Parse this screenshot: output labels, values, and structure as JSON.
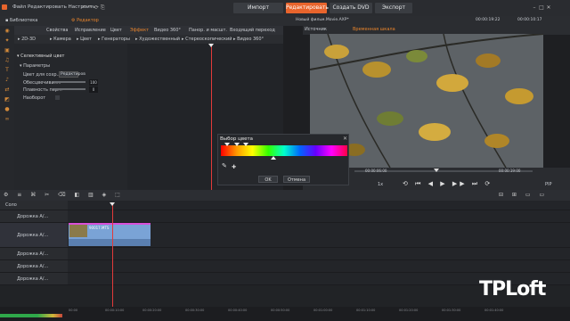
{
  "menu": [
    "Файл",
    "Редактировать",
    "Настроить"
  ],
  "top_buttons": {
    "import": "Импорт",
    "edit": "Редактировать",
    "create_dvd": "Создать DVD",
    "export": "Экспорт"
  },
  "tabs": {
    "library": "Библиотека",
    "editor": "Редактор",
    "properties": "Свойства",
    "fix": "Исправление",
    "color": "Цвет",
    "effect": "Эффект",
    "video360": "Видео 360°",
    "pan": "Панор. и масшт.",
    "transition": "Входящий переход"
  },
  "effect_categories": [
    "2D-3D",
    "Камера",
    "Цвет",
    "Генераторы",
    "Художественный",
    "Стереоскопический",
    "Видео 360°"
  ],
  "panel": {
    "title": "Селективный цвет",
    "section": "Параметры",
    "rows": [
      {
        "label": "Цвет для сохр...",
        "value": "Редактиров"
      },
      {
        "label": "Обесцвечиван...",
        "value": "100"
      },
      {
        "label": "Плавность пер...",
        "value": "0"
      },
      {
        "label": "Наоборот",
        "value": ""
      }
    ]
  },
  "preview": {
    "tab_source": "Источник",
    "tab_timeline": "Временная шкала",
    "file": "Новый фильм.Movie.AXP*",
    "timecode_left": "00:00:19:22",
    "timecode_right": "00:00:10:17",
    "zoom": "1x",
    "tc1": "00:00:06:00",
    "tc2": "00:00:19:00",
    "pip": "PIP"
  },
  "dialog": {
    "title": "Выбор цвета",
    "ok": "OK",
    "cancel": "Отмена"
  },
  "timeline": {
    "solo": "Соло",
    "tracks": [
      "Дорожка А/...",
      "Дорожка А/...",
      "Дорожка А/...",
      "Дорожка А/...",
      "Дорожка А/..."
    ],
    "clip_name": "90017.MTS",
    "ticks": [
      "00:00",
      "00:00:10:00",
      "00:00:20:00",
      "00:00:30:00",
      "00:00:40:00",
      "00:00:50:00",
      "00:01:00:00",
      "00:01:10:00",
      "00:01:20:00",
      "00:01:30:00",
      "00:01:40:00"
    ]
  },
  "watermark": "TPLoft",
  "colors": {
    "accent": "#e8642c",
    "playhead": "#e23a3a",
    "clip": "#7aa3d6",
    "clip_top": "#d94fd8"
  }
}
